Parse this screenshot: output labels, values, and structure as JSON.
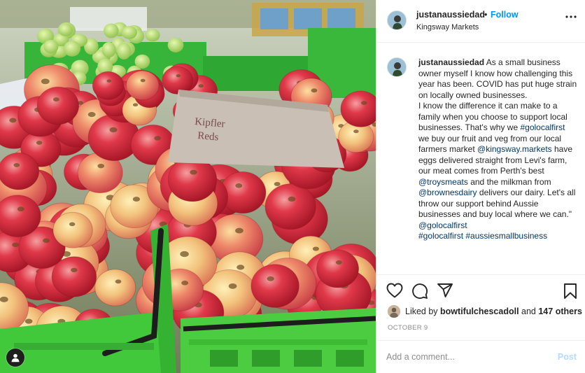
{
  "post": {
    "username": "justanaussiedad",
    "separator": "•",
    "follow_label": "Follow",
    "location": "Kingsway Markets",
    "photo_signs": [
      "Kipfler",
      "Reds"
    ]
  },
  "caption": {
    "username": "justanaussiedad",
    "lines": [
      " As a small business owner myself I know how challenging this year has been. COVID has put huge strain on locally owned businesses.",
      "I know the difference it can make to a family when you choose to support local businesses. That's why we "
    ],
    "tag1": "#golocalfirst",
    "seg1": " we buy our fruit and veg from our local farmers market ",
    "tag2": "@kingsway.markets",
    "seg2": " have eggs delivered straight from Levi's farm, our meat comes from Perth's best ",
    "tag3": "@troysmeats",
    "seg3": " and the milkman from ",
    "tag4": "@brownesdairy",
    "seg4": " delivers our dairy. Let's all throw our support behind Aussie businesses and buy local where we can.\" ",
    "tag5": "@golocalfirst",
    "tag6": "#golocalfirst",
    "tag7": "#aussiesmallbusiness"
  },
  "likes": {
    "prefix": "Liked by ",
    "user": "bowtifulchescadoll",
    "middle": " and ",
    "count": "147 others"
  },
  "date": "October 9",
  "comment": {
    "placeholder": "Add a comment...",
    "post_label": "Post"
  },
  "icons": {
    "more": "more-horizontal-icon",
    "like": "heart-icon",
    "comment": "comment-icon",
    "share": "share-icon",
    "save": "bookmark-icon",
    "user": "user-icon"
  },
  "colors": {
    "accent": "#0095f6",
    "link": "#00376b",
    "muted": "#8e8e8e",
    "post_disabled": "#b3dbff",
    "crate_green": "#3fc43a",
    "apple_red": "#c8202e"
  }
}
